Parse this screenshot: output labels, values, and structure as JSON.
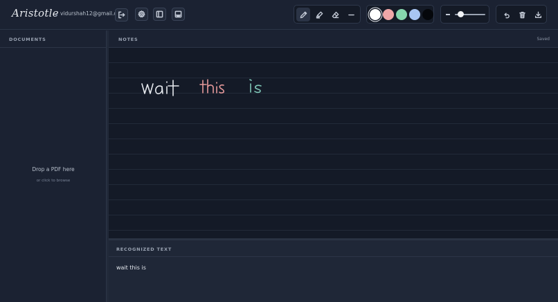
{
  "app": {
    "brand": "Aristotle",
    "user_email": "vidurshah12@gmail.com"
  },
  "toolbar": {
    "left_icons": [
      "logout-icon",
      "settings-icon",
      "sidebar-left-icon",
      "panel-bottom-icon"
    ],
    "tools": [
      {
        "name": "pen",
        "icon": "pencil-icon",
        "active": true
      },
      {
        "name": "highlighter",
        "icon": "highlighter-icon",
        "active": false
      },
      {
        "name": "eraser",
        "icon": "eraser-icon",
        "active": false
      },
      {
        "name": "line",
        "icon": "line-icon",
        "active": false
      }
    ],
    "colors": [
      {
        "name": "white",
        "hex": "#ffffff",
        "selected": true
      },
      {
        "name": "pink",
        "hex": "#f0a7a8",
        "selected": false
      },
      {
        "name": "green",
        "hex": "#86d6ae",
        "selected": false
      },
      {
        "name": "blue",
        "hex": "#a9c6f2",
        "selected": false
      },
      {
        "name": "black",
        "hex": "#05070b",
        "selected": false
      }
    ],
    "stroke_width_fraction": 0.2,
    "actions": [
      "undo-icon",
      "trash-icon",
      "download-icon"
    ]
  },
  "documents": {
    "header": "DOCUMENTS",
    "drop_title": "Drop a PDF here",
    "drop_subtitle": "or click to browse"
  },
  "notes": {
    "header": "NOTES",
    "status": "Saved",
    "handwriting": [
      {
        "word": "wait",
        "color": "#e6e9ee"
      },
      {
        "word": "this",
        "color": "#e79a9b"
      },
      {
        "word": "is",
        "color": "#7fc7b8"
      }
    ]
  },
  "recognized": {
    "header": "RECOGNIZED TEXT",
    "text": "wait this is"
  },
  "colors": {
    "background": "#1a2130",
    "canvas": "#141a27",
    "border": "#2c3547"
  }
}
